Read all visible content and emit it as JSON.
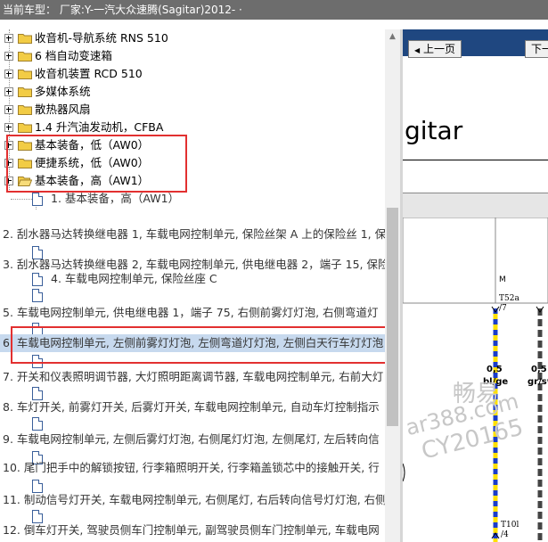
{
  "titlebar": {
    "text": "当前车型：  厂家:Y-一汽大众速腾(Sagitar)2012-    ·"
  },
  "tree": {
    "folders": [
      {
        "label": "收音机-导航系统 RNS 510"
      },
      {
        "label": "6 档自动变速箱"
      },
      {
        "label": "收音机装置 RCD 510"
      },
      {
        "label": "多媒体系统"
      },
      {
        "label": "散热器风扇"
      },
      {
        "label": "1.4 升汽油发动机，CFBA"
      },
      {
        "label": "基本装备，低（AW0）"
      },
      {
        "label": "便捷系统，低（AW0）"
      },
      {
        "label": "基本装备，高（AW1）"
      }
    ],
    "docs": [
      {
        "label": "1. 基本装备，高（AW1）"
      },
      {
        "label": "2. 刮水器马达转换继电器 1, 车载电网控制单元, 保险丝架 A 上的保险丝 1, 保"
      },
      {
        "label": "3. 刮水器马达转换继电器 2, 车载电网控制单元, 供电继电器 2，端子 15, 保险"
      },
      {
        "label": "4. 车载电网控制单元, 保险丝座 C"
      },
      {
        "label": "5. 车载电网控制单元, 供电继电器 1，端子 75, 右侧前雾灯灯泡, 右侧弯道灯"
      },
      {
        "label": "6. 车载电网控制单元, 左侧前雾灯灯泡, 左侧弯道灯灯泡, 左侧白天行车灯灯泡"
      },
      {
        "label": "7. 开关和仪表照明调节器, 大灯照明距离调节器, 车载电网控制单元, 右前大灯"
      },
      {
        "label": "8. 车灯开关, 前雾灯开关, 后雾灯开关, 车载电网控制单元, 自动车灯控制指示"
      },
      {
        "label": "9. 车载电网控制单元, 左侧后雾灯灯泡, 右侧尾灯灯泡, 左侧尾灯, 左后转向信"
      },
      {
        "label": "10. 尾门把手中的解锁按钮, 行李箱照明开关, 行李箱盖锁芯中的接触开关, 行"
      },
      {
        "label": "11. 制动信号灯开关, 车载电网控制单元, 右侧尾灯, 右后转向信号灯灯泡, 右侧"
      },
      {
        "label": "12. 倒车灯开关, 驾驶员侧车门控制单元, 副驾驶员侧车门控制单元, 车载电网"
      }
    ]
  },
  "viewer": {
    "prev_page": "上一页",
    "next_page": "下一",
    "title_fragment": "gitar",
    "wire1_label_top": "T52a",
    "wire1_label_bottom": "/7",
    "wire1_size": "0,5",
    "wire1_color": "bl/ge",
    "wire2_size": "0,5",
    "wire2_color": "gr/sw",
    "conn_m": "M",
    "conn_bottom_top": "T10l",
    "conn_bottom_bottom": "/4"
  },
  "watermark": {
    "line1": "畅易",
    "line2": "ar388.com",
    "line3": "CY20165"
  },
  "colors": {
    "titlebar": "#6d6d6d",
    "viewer_toolbar": "#1f4780",
    "highlight": "#c7d9ee",
    "annotation_red": "#e23030",
    "folder_yellow": "#f2cc45"
  }
}
